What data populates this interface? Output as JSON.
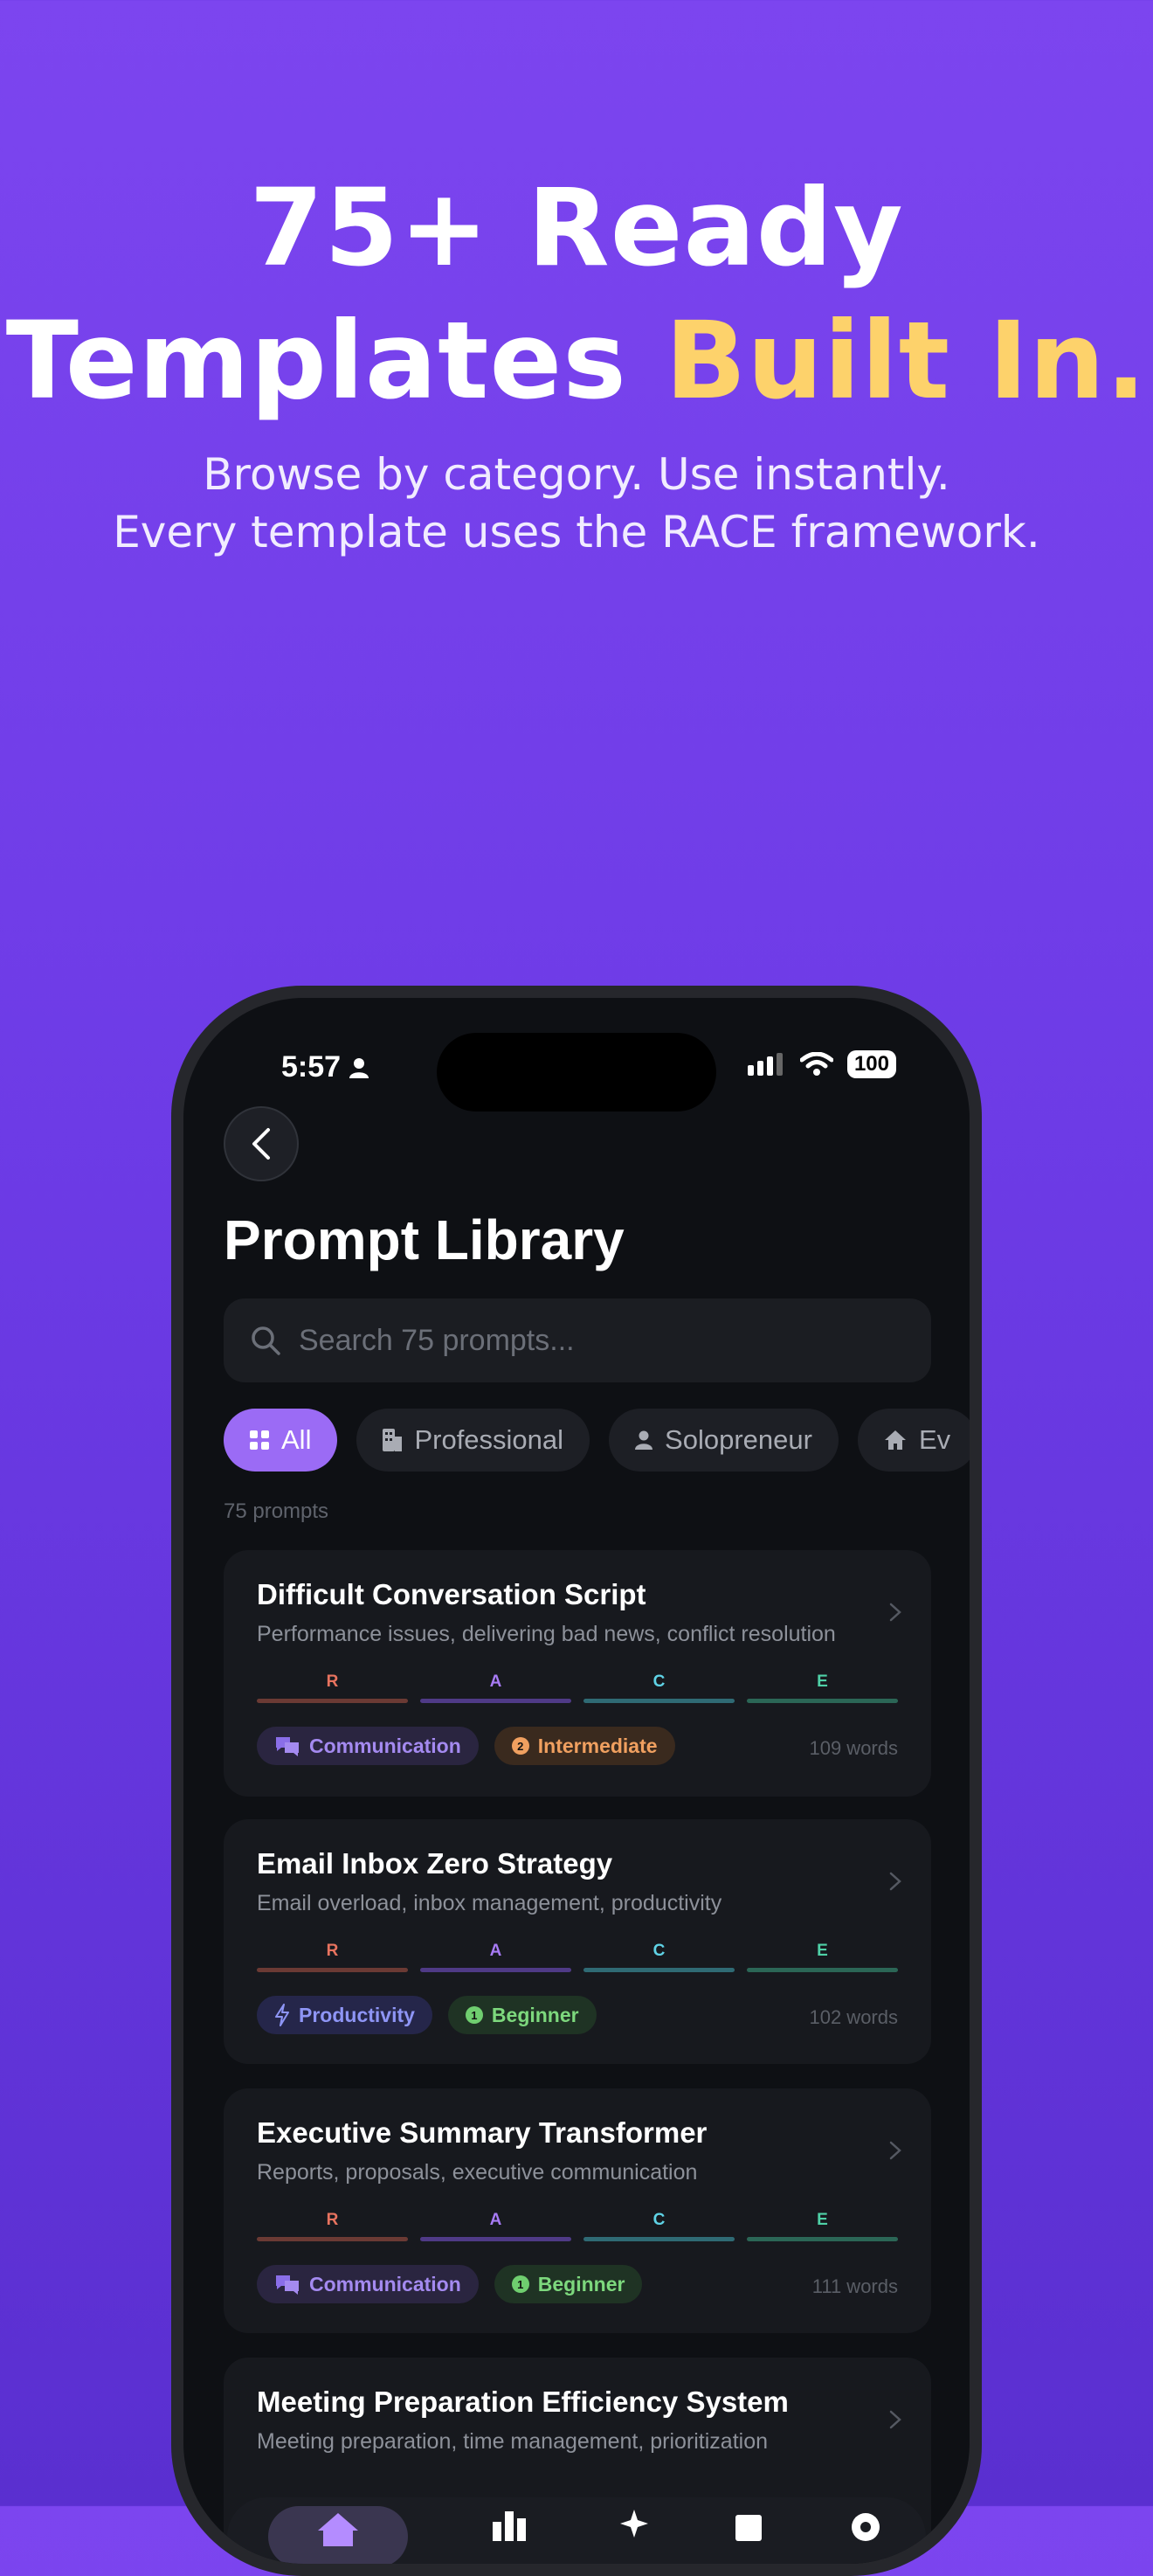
{
  "hero": {
    "line1": "75+ Ready",
    "line2_plain": "Templates ",
    "line2_accent": "Built In.",
    "sub1": "Browse by category. Use instantly.",
    "sub2": "Every template uses the RACE framework."
  },
  "status": {
    "time": "5:57",
    "battery": "100"
  },
  "screen": {
    "title": "Prompt Library",
    "search_placeholder": "Search 75 prompts...",
    "count": "75 prompts"
  },
  "chips": [
    {
      "label": "All",
      "icon": "grid-icon"
    },
    {
      "label": "Professional",
      "icon": "building-icon"
    },
    {
      "label": "Solopreneur",
      "icon": "person-icon"
    },
    {
      "label": "Ev",
      "icon": "home-icon"
    }
  ],
  "race_letters": [
    "R",
    "A",
    "C",
    "E"
  ],
  "colors": {
    "accent": "#9b6bf5",
    "headline_accent": "#fdd26b",
    "race_r": "#e8735f",
    "race_a": "#a77bf5",
    "race_c": "#5fd3e6",
    "race_e": "#4fd1a7"
  },
  "cards": [
    {
      "title": "Difficult Conversation Script",
      "desc": "Performance issues, delivering bad news, conflict resolution",
      "category": "Communication",
      "category_icon": "chat-bubbles-icon",
      "level": "Intermediate",
      "level_num": "2",
      "words": "109 words"
    },
    {
      "title": "Email Inbox Zero Strategy",
      "desc": "Email overload, inbox management, productivity",
      "category": "Productivity",
      "category_icon": "lightning-icon",
      "level": "Beginner",
      "level_num": "1",
      "words": "102 words"
    },
    {
      "title": "Executive Summary Transformer",
      "desc": "Reports, proposals, executive communication",
      "category": "Communication",
      "category_icon": "chat-bubbles-icon",
      "level": "Beginner",
      "level_num": "1",
      "words": "111 words"
    },
    {
      "title": "Meeting Preparation Efficiency System",
      "desc": "Meeting preparation, time management, prioritization"
    }
  ]
}
